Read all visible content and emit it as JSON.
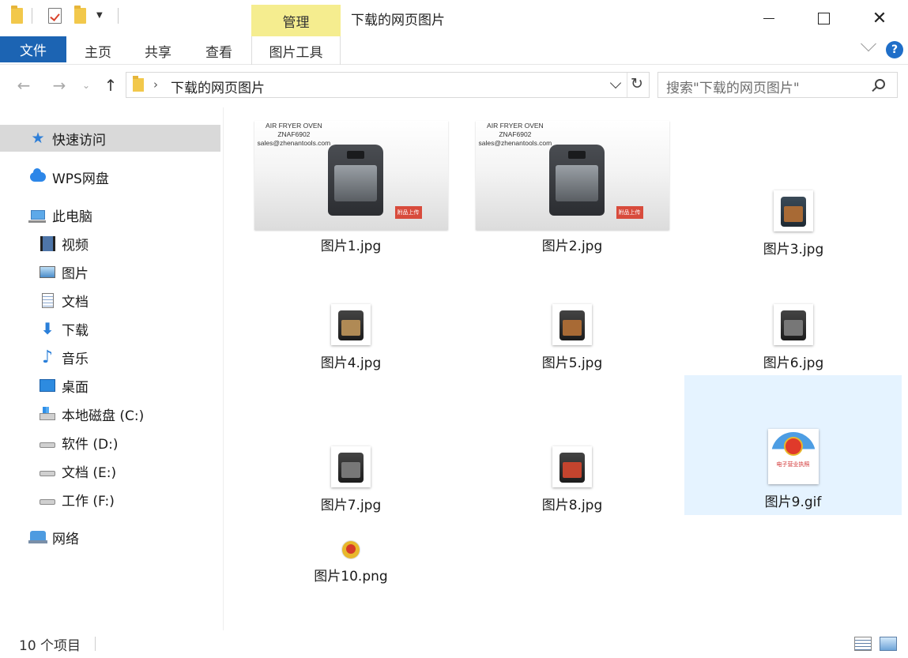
{
  "window": {
    "title": "下载的网页图片",
    "contextual_tab": "管理"
  },
  "ribbon": {
    "tabs": [
      "文件",
      "主页",
      "共享",
      "查看",
      "图片工具"
    ]
  },
  "address": {
    "path": "下载的网页图片",
    "search_placeholder": "搜索\"下载的网页图片\""
  },
  "sidebar": {
    "quick_access": "快速访问",
    "wps": "WPS网盘",
    "this_pc": "此电脑",
    "items": [
      "视频",
      "图片",
      "文档",
      "下载",
      "音乐",
      "桌面",
      "本地磁盘 (C:)",
      "软件 (D:)",
      "文档 (E:)",
      "工作 (F:)"
    ],
    "network": "网络"
  },
  "files": [
    {
      "name": "图片1.jpg"
    },
    {
      "name": "图片2.jpg"
    },
    {
      "name": "图片3.jpg"
    },
    {
      "name": "图片4.jpg"
    },
    {
      "name": "图片5.jpg"
    },
    {
      "name": "图片6.jpg"
    },
    {
      "name": "图片7.jpg"
    },
    {
      "name": "图片8.jpg"
    },
    {
      "name": "图片9.gif",
      "selected": true
    },
    {
      "name": "图片10.png"
    }
  ],
  "thumb_text": {
    "line1": "AIR FRYER OVEN",
    "line2": "ZNAF6902",
    "line3": "sales@zhenantools.com",
    "stamp": "附品上传",
    "badge": "电子营业执照"
  },
  "status": {
    "count": "10 个项目"
  },
  "colors": {
    "accent": "#1c64b3",
    "manage_tab": "#f5ed8f",
    "selection": "#e5f3ff",
    "nav_selected": "#d9d9d9"
  }
}
